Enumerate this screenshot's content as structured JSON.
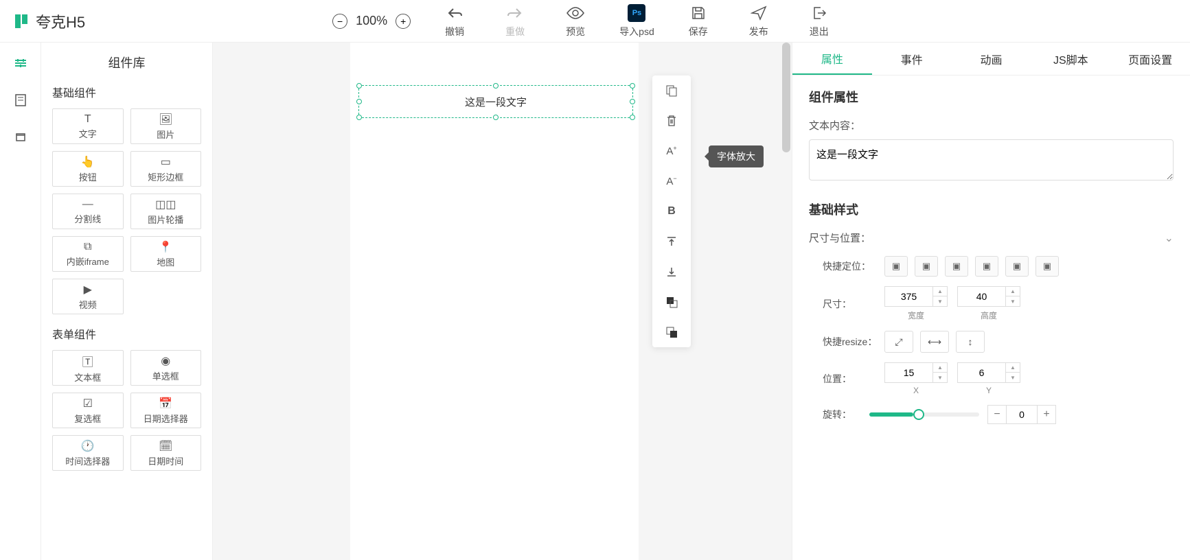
{
  "app_name": "夸克H5",
  "toolbar": {
    "zoom": "100%",
    "undo": "撤销",
    "redo": "重做",
    "preview": "预览",
    "import_psd": "导入psd",
    "save": "保存",
    "publish": "发布",
    "exit": "退出"
  },
  "comp_panel": {
    "title": "组件库",
    "section_basic": "基础组件",
    "section_form": "表单组件",
    "basic_items": [
      "文字",
      "图片",
      "按钮",
      "矩形边框",
      "分割线",
      "图片轮播",
      "内嵌iframe",
      "地图",
      "视频"
    ],
    "form_items": [
      "文本框",
      "单选框",
      "复选框",
      "日期选择器",
      "时间选择器",
      "日期时间"
    ]
  },
  "canvas": {
    "selected_text": "这是一段文字"
  },
  "float_tooltip": "字体放大",
  "tabs": {
    "attr": "属性",
    "event": "事件",
    "animation": "动画",
    "script": "JS脚本",
    "page_setting": "页面设置"
  },
  "right": {
    "comp_attr_title": "组件属性",
    "text_content_label": "文本内容：",
    "text_content_value": "这是一段文字",
    "basic_style_title": "基础样式",
    "size_pos_label": "尺寸与位置：",
    "quick_pos_label": "快捷定位：",
    "size_label": "尺寸：",
    "width_value": "375",
    "width_sublabel": "宽度",
    "height_value": "40",
    "height_sublabel": "高度",
    "resize_label": "快捷resize：",
    "position_label": "位置：",
    "x_value": "15",
    "x_sublabel": "X",
    "y_value": "6",
    "y_sublabel": "Y",
    "rotate_label": "旋转：",
    "rotate_value": "0"
  }
}
